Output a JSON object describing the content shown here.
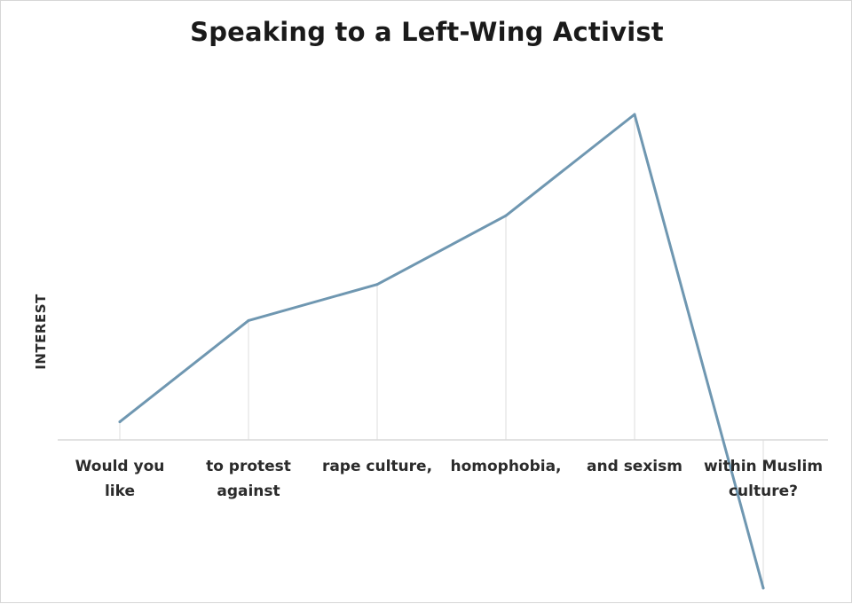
{
  "chart_data": {
    "type": "line",
    "title": "Speaking to a Left-Wing Activist",
    "xlabel": "",
    "ylabel": "INTEREST",
    "categories": [
      "Would you like",
      "to protest against",
      "rape culture,",
      "homophobia,",
      "and sexism",
      "within Muslim culture?"
    ],
    "category_lines": [
      [
        "Would you",
        "like"
      ],
      [
        "to protest",
        "against"
      ],
      [
        "rape culture,"
      ],
      [
        "homophobia,"
      ],
      [
        "and sexism"
      ],
      [
        "within Muslim",
        "culture?"
      ]
    ],
    "series": [
      {
        "values": [
          5,
          33,
          43,
          62,
          90,
          -38
        ],
        "color": "#6f97b1"
      }
    ],
    "ylim": [
      -38,
      95
    ],
    "grid": "vertical gridlines at categories",
    "legend": "none",
    "axis_color": "#d9d9d9",
    "grid_color": "#dddddd"
  }
}
